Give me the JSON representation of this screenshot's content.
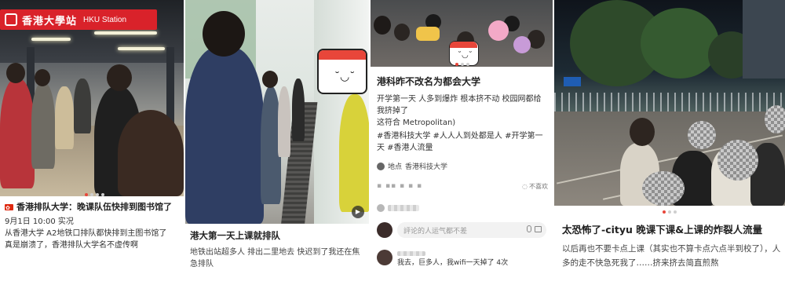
{
  "cards": [
    {
      "sign_cn": "香港大學站",
      "sign_en": "HKU Station",
      "title": "香港排队大学：晚课队伍快排到图书馆了",
      "body_lines": [
        "9月1日 10:00 实况",
        "从香港大学 A2地铁口排队都快排到主图书馆了",
        "真是崩溃了，香港排队大学名不虚传啊"
      ]
    },
    {
      "title": "港大第一天上课就排队",
      "body": "地铁出站超多人 排出二里地去 快迟到了我还在焦急排队"
    },
    {
      "title": "港科昨不改名为都会大学",
      "body_lines": [
        "开学第一天 人多到爆炸 根本挤不动 校园网都给我挤掉了",
        "这符合 Metropolitan)"
      ],
      "tags": "#香港科技大学 #人人人到处都是人 #开学第一天 #香港人流量",
      "location_label": "地点",
      "location": "香港科技大学",
      "unlike": "不喜欢",
      "comment_placeholder": "評论的人运气都不差",
      "comment_text": "我去，巨多人，我wifi一天掉了 4次"
    },
    {
      "title": "太恐怖了-cityu 晚课下课&上课的炸裂人流量",
      "body": "以后再也不要卡点上课（其实也不算卡点六点半到校了），人多的走不快急死我了……挤来挤去简直煎熬"
    }
  ],
  "colors": {
    "accent": "#e8463a",
    "mtr_red": "#d9222a"
  },
  "icons": [
    "hk-flag-icon",
    "location-icon",
    "mic-icon",
    "image-icon",
    "play-icon",
    "calendar-sticker-icon"
  ]
}
